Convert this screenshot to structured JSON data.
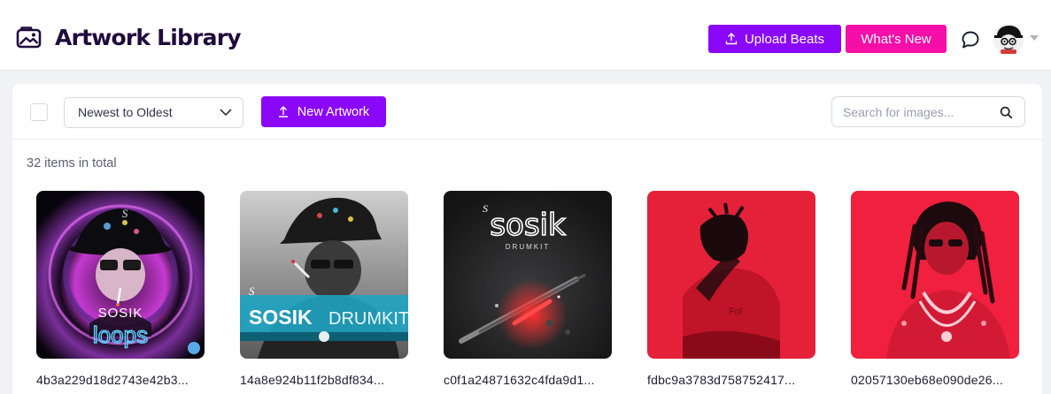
{
  "header": {
    "title": "Artwork Library",
    "upload_label": "Upload Beats",
    "whats_new_label": "What's New",
    "icons": [
      "gallery-icon",
      "upload-icon",
      "chat-icon",
      "avatar",
      "caret-down-icon"
    ]
  },
  "toolbar": {
    "sort_selected": "Newest to Oldest",
    "new_artwork_label": "New Artwork",
    "search_placeholder": "Search for images..."
  },
  "library": {
    "count_text": "32 items in total",
    "items": [
      {
        "filename": "4b3a229d18d2743e42b3...",
        "art_text": [
          "SOSIK",
          "loops"
        ]
      },
      {
        "filename": "14a8e924b11f2b8df834...",
        "art_text": [
          "SOSIK",
          "DRUMKIT"
        ]
      },
      {
        "filename": "c0f1a24871632c4fda9d1...",
        "art_text": [
          "sosik",
          "DRUMKIT"
        ]
      },
      {
        "filename": "fdbc9a3783d758752417...",
        "art_text": []
      },
      {
        "filename": "02057130eb68e090de26...",
        "art_text": []
      }
    ]
  },
  "colors": {
    "primary": "#8a07f9",
    "accent": "#f50ea7",
    "title": "#200b3c"
  }
}
